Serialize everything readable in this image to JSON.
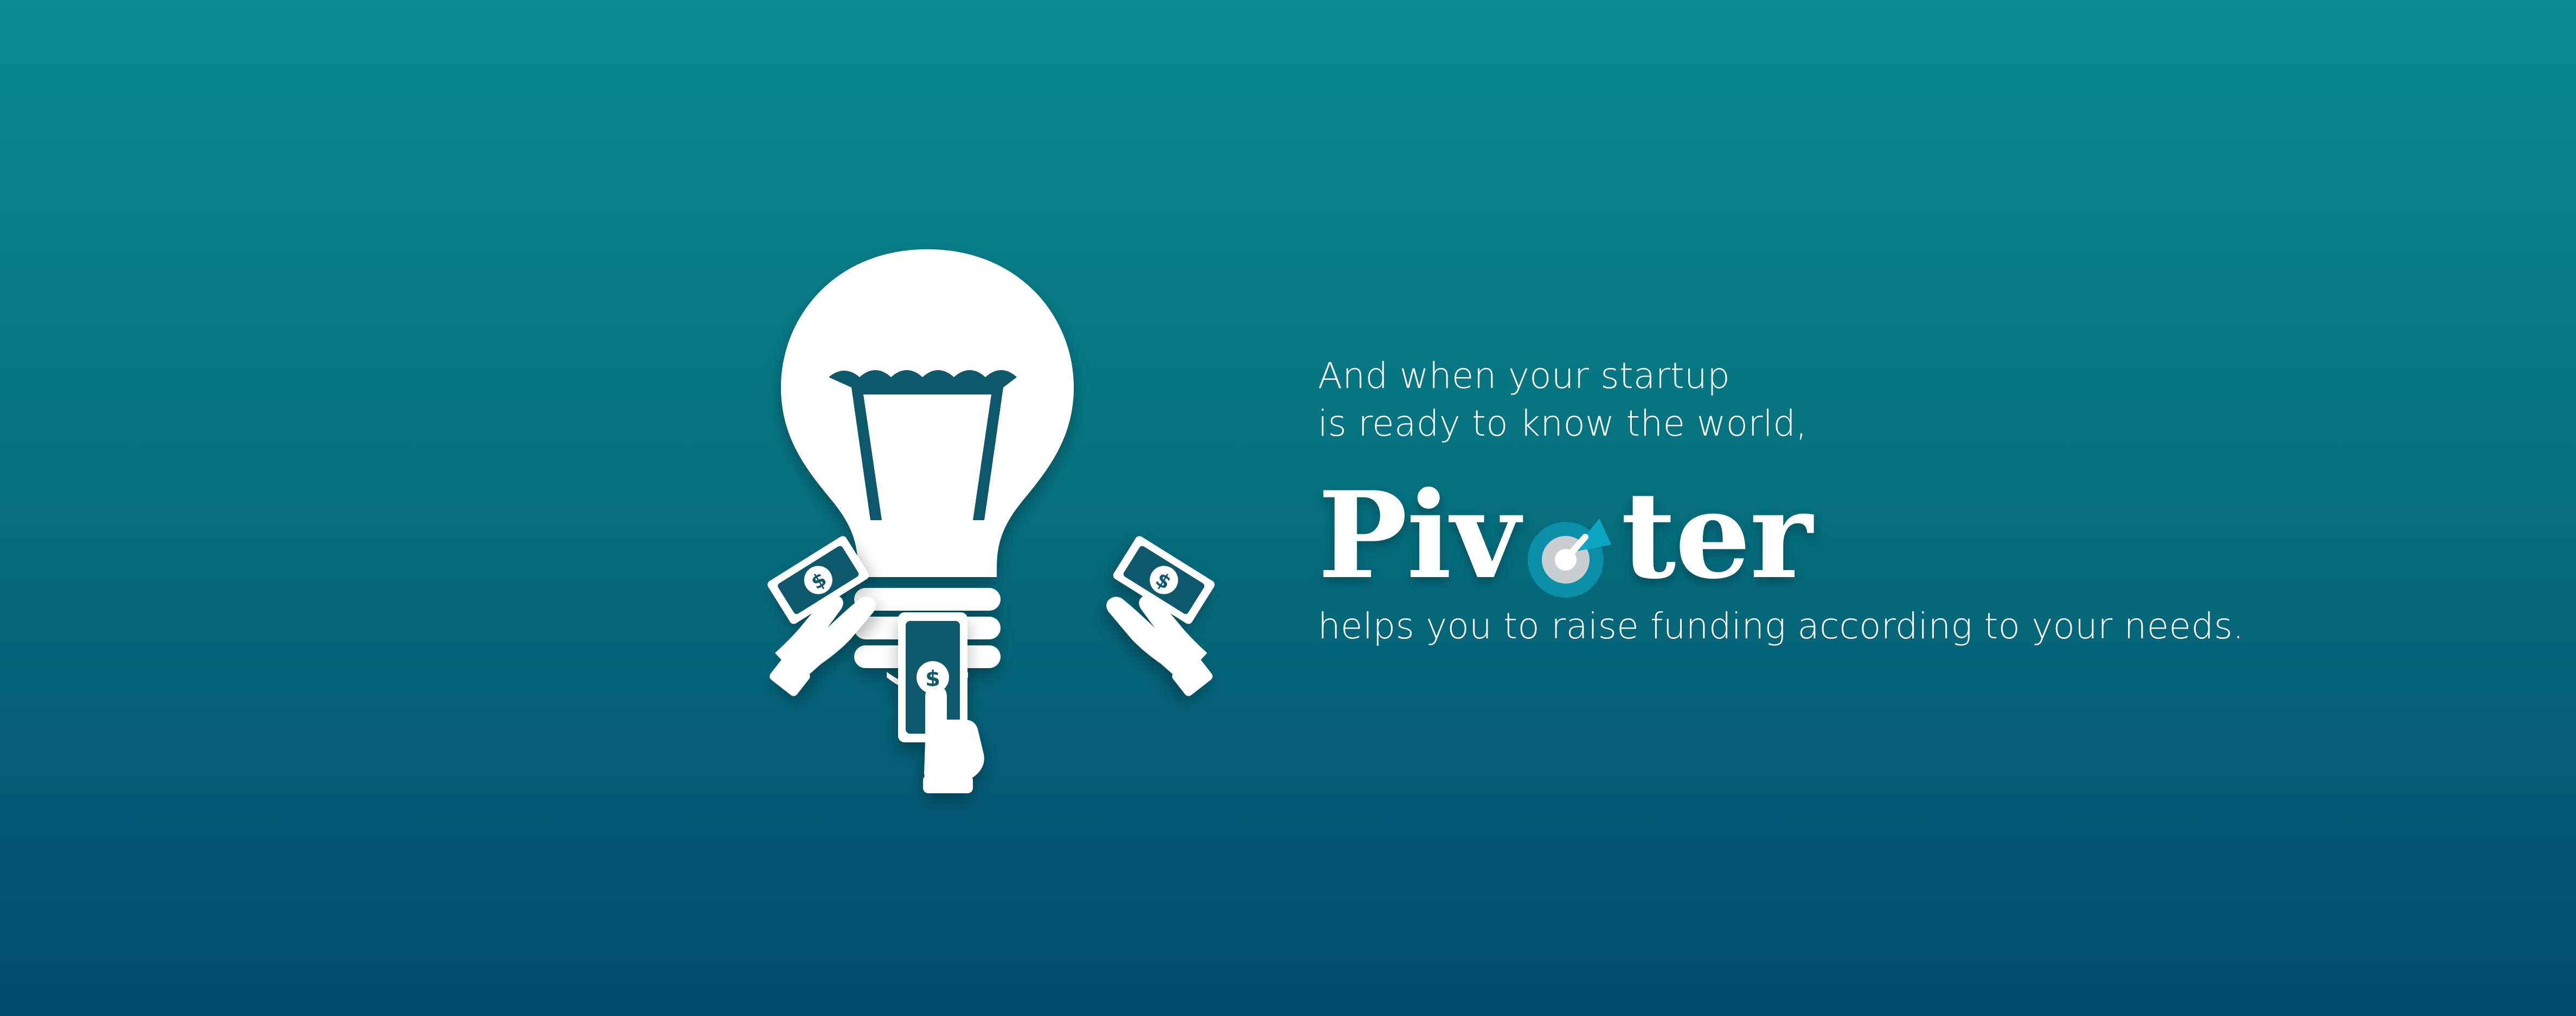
{
  "page": {
    "background_colors": {
      "top": "#088b92",
      "middle": "#06727f",
      "bottom": "#024b6d"
    },
    "text_color": "#ffffff"
  },
  "illustration": {
    "icons": [
      "lightbulb-icon",
      "hand-with-dollar-bill-icon",
      "hand-with-dollar-bill-icon",
      "hand-with-dollar-bill-icon"
    ]
  },
  "copy": {
    "line_1": "And when your startup",
    "line_2": "is ready to know the world,",
    "brand": {
      "name": "Pivoter",
      "before_mark": "Piv",
      "after_mark": "ter",
      "accent_colors": {
        "ring": "#0b8fa8",
        "arrow": "#0aa6c4",
        "center": "#c9ced1"
      }
    },
    "line_3": "helps you to raise funding according to your needs."
  }
}
